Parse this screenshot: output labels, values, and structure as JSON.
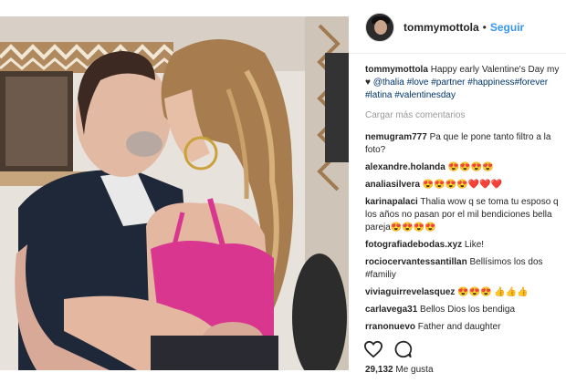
{
  "post": {
    "username": "tommymottola",
    "separator": "•",
    "follow_label": "Seguir",
    "caption_user": "tommymottola",
    "caption_parts": [
      {
        "text": "Happy early Valentine's Day my ",
        "tag": false
      },
      {
        "text": "♥",
        "tag": false
      },
      {
        "text": " ",
        "tag": false
      },
      {
        "text": "@thalia",
        "tag": true
      },
      {
        "text": " ",
        "tag": false
      },
      {
        "text": "#love",
        "tag": true
      },
      {
        "text": " ",
        "tag": false
      },
      {
        "text": "#partner",
        "tag": true
      },
      {
        "text": " ",
        "tag": false
      },
      {
        "text": "#happiness",
        "tag": true
      },
      {
        "text": "#forever",
        "tag": true
      },
      {
        "text": " ",
        "tag": false
      },
      {
        "text": "#latina",
        "tag": true
      },
      {
        "text": " ",
        "tag": false
      },
      {
        "text": "#valentinesday",
        "tag": true
      }
    ],
    "load_more_label": "Cargar más comentarios",
    "comments": [
      {
        "user": "nemugram777",
        "text": "Pa que le pone tanto filtro a la foto?"
      },
      {
        "user": "alexandre.holanda",
        "text": "😍😍😍😍"
      },
      {
        "user": "analiasilvera",
        "text": "😍😍😍😍❤️❤️❤️"
      },
      {
        "user": "karinapalaci",
        "text": "Thalia wow q se toma tu esposo q los años no pasan por el mil bendiciones bella pareja😍😍😍😍"
      },
      {
        "user": "fotografiadebodas.xyz",
        "text": "Like!"
      },
      {
        "user": "rociocervantessantillan",
        "text": "Bellísimos los dos #familiy"
      },
      {
        "user": "viviaguirrevelasquez",
        "text": "😍😍😍 👍👍👍"
      },
      {
        "user": "carlavega31",
        "text": "Bellos Dios los bendiga"
      },
      {
        "user": "rranonuevo",
        "text": "Father and daughter"
      }
    ],
    "likes_count": "29,132",
    "likes_label": "Me gusta",
    "icons": {
      "like": "heart-outline-icon",
      "comment": "comment-bubble-icon"
    },
    "colors": {
      "link": "#3897f0",
      "hashtag": "#003569",
      "muted": "#999999",
      "text": "#262626"
    }
  }
}
